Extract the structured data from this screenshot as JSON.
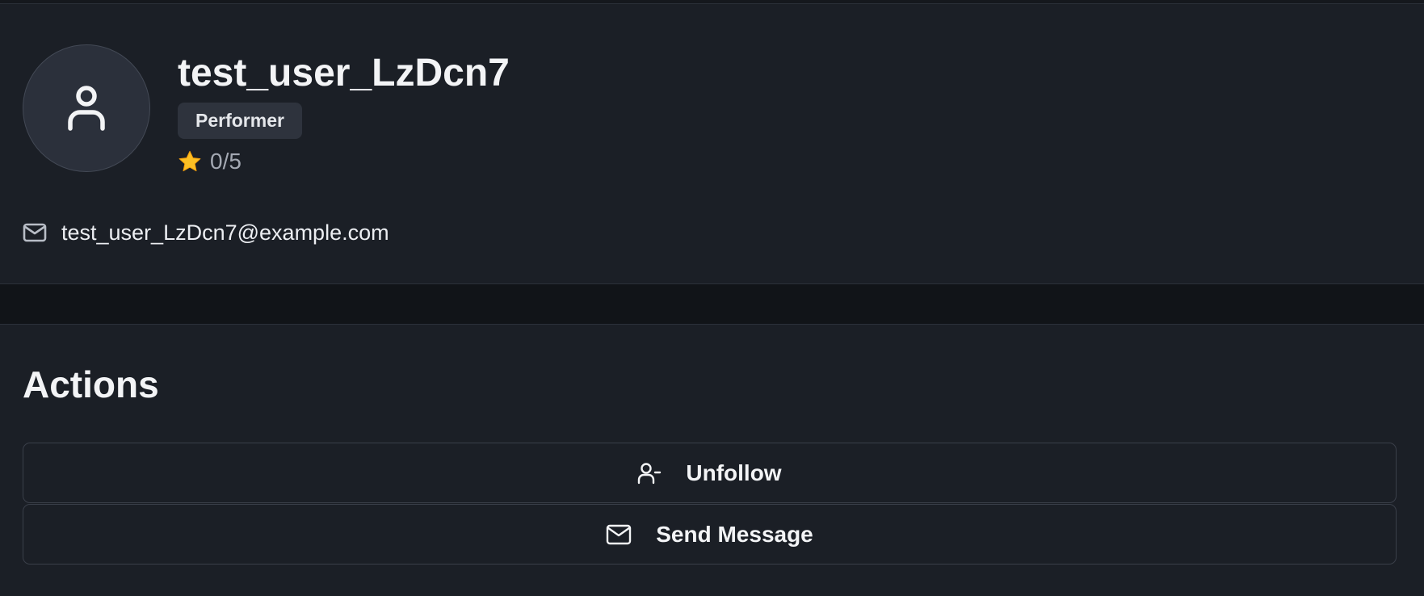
{
  "profile": {
    "username": "test_user_LzDcn7",
    "role": "Performer",
    "rating": "0/5",
    "email": "test_user_LzDcn7@example.com",
    "avatar_icon": "user-icon",
    "rating_icon": "star-icon",
    "email_icon": "mail-icon"
  },
  "actions": {
    "heading": "Actions",
    "unfollow_label": "Unfollow",
    "unfollow_icon": "user-minus-icon",
    "send_message_label": "Send Message",
    "send_message_icon": "mail-icon"
  },
  "colors": {
    "page_background": "#111418",
    "card_background": "#1b1f26",
    "star": "#fbbf24",
    "text_primary": "#f3f4f6",
    "text_muted": "#a4a9b3"
  }
}
